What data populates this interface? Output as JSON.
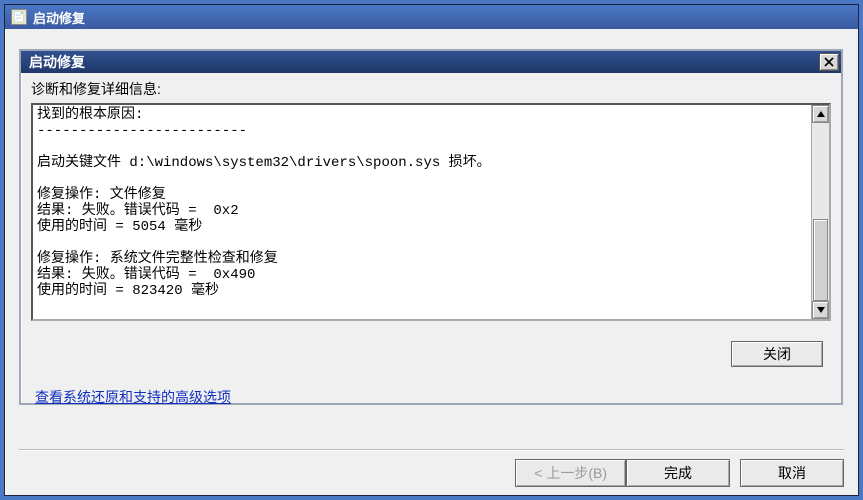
{
  "outer_window": {
    "title": "启动修复"
  },
  "dialog": {
    "title": "启动修复",
    "details_label": "诊断和修复详细信息:",
    "close_button_label": "关闭",
    "log_lines": {
      "l1": "找到的根本原因:",
      "dash": "-------------------------",
      "l3": "启动关键文件 d:\\windows\\system32\\drivers\\spoon.sys 损坏。",
      "l5": "修复操作: 文件修复",
      "l6": "结果: 失败。错误代码 =  0x2",
      "l7": "使用的时间 = 5054 毫秒",
      "l9": "修复操作: 系统文件完整性检查和修复",
      "l10": "结果: 失败。错误代码 =  0x490",
      "l11": "使用的时间 = 823420 毫秒"
    }
  },
  "link": {
    "advanced_options": "查看系统还原和支持的高级选项"
  },
  "wizard": {
    "back": "< 上一步(B)",
    "finish": "完成",
    "cancel": "取消"
  }
}
